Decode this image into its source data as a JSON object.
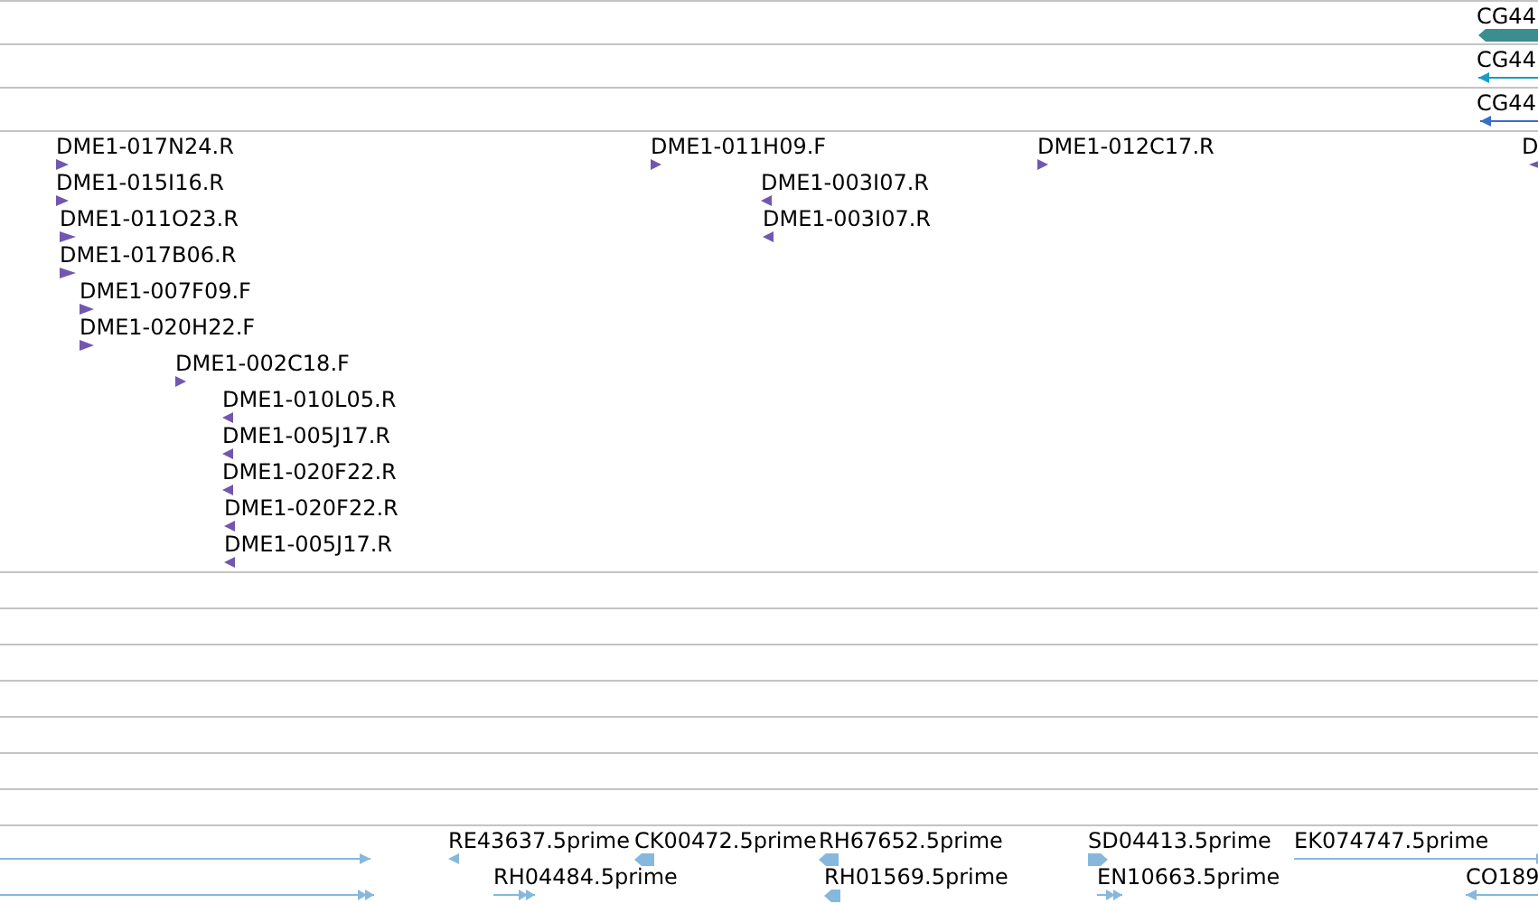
{
  "tracks": [
    {
      "color": "#3b8e90",
      "features": [
        {
          "label": "CG44",
          "reverse": true,
          "kind": "bar"
        }
      ]
    },
    {
      "color": "#1c9cc4",
      "features": [
        {
          "label": "CG44",
          "reverse": true,
          "kind": "line"
        }
      ]
    },
    {
      "color": "#3a6cc8",
      "features": [
        {
          "label": "CG44",
          "reverse": true,
          "kind": "line"
        }
      ]
    },
    {
      "color": "#7257b0",
      "features": [
        {
          "label": "DME1-017N24.R",
          "reverse": false,
          "kind": "small"
        },
        {
          "label": "DME1-015I16.R",
          "reverse": false,
          "kind": "small"
        },
        {
          "label": "DME1-011O23.R",
          "reverse": false,
          "kind": "small"
        },
        {
          "label": "DME1-017B06.R",
          "reverse": false,
          "kind": "small"
        },
        {
          "label": "DME1-007F09.F",
          "reverse": false,
          "kind": "small"
        },
        {
          "label": "DME1-020H22.F",
          "reverse": false,
          "kind": "small"
        },
        {
          "label": "DME1-002C18.F",
          "reverse": false,
          "kind": "small"
        },
        {
          "label": "DME1-010L05.R",
          "reverse": true,
          "kind": "small"
        },
        {
          "label": "DME1-005J17.R",
          "reverse": true,
          "kind": "small"
        },
        {
          "label": "DME1-020F22.R",
          "reverse": true,
          "kind": "small"
        },
        {
          "label": "DME1-020F22.R",
          "reverse": true,
          "kind": "small"
        },
        {
          "label": "DME1-005J17.R",
          "reverse": true,
          "kind": "small"
        },
        {
          "label": "DME1-011H09.F",
          "reverse": false,
          "kind": "small"
        },
        {
          "label": "DME1-003I07.R",
          "reverse": true,
          "kind": "small"
        },
        {
          "label": "DME1-003I07.R",
          "reverse": true,
          "kind": "small"
        },
        {
          "label": "DME1-012C17.R",
          "reverse": false,
          "kind": "small"
        },
        {
          "label": "D",
          "reverse": true,
          "kind": "small"
        }
      ]
    },
    {
      "color": "#86b8de",
      "features": [
        {
          "reverse": false,
          "kind": "line"
        },
        {
          "reverse": false,
          "kind": "double"
        },
        {
          "label": "RE43637.5prime",
          "reverse": true,
          "kind": "small"
        },
        {
          "label": "CK00472.5prime",
          "reverse": true,
          "kind": "bar"
        },
        {
          "label": "RH67652.5prime",
          "reverse": true,
          "kind": "bar"
        },
        {
          "label": "SD04413.5prime",
          "reverse": false,
          "kind": "bar"
        },
        {
          "label": "EK074747.5prime",
          "reverse": false,
          "kind": "line"
        },
        {
          "label": "RH04484.5prime",
          "reverse": false,
          "kind": "double"
        },
        {
          "label": "RH01569.5prime",
          "reverse": true,
          "kind": "bar"
        },
        {
          "label": "EN10663.5prime",
          "reverse": false,
          "kind": "double"
        },
        {
          "label": "CO189",
          "reverse": true,
          "kind": "line"
        }
      ]
    }
  ]
}
